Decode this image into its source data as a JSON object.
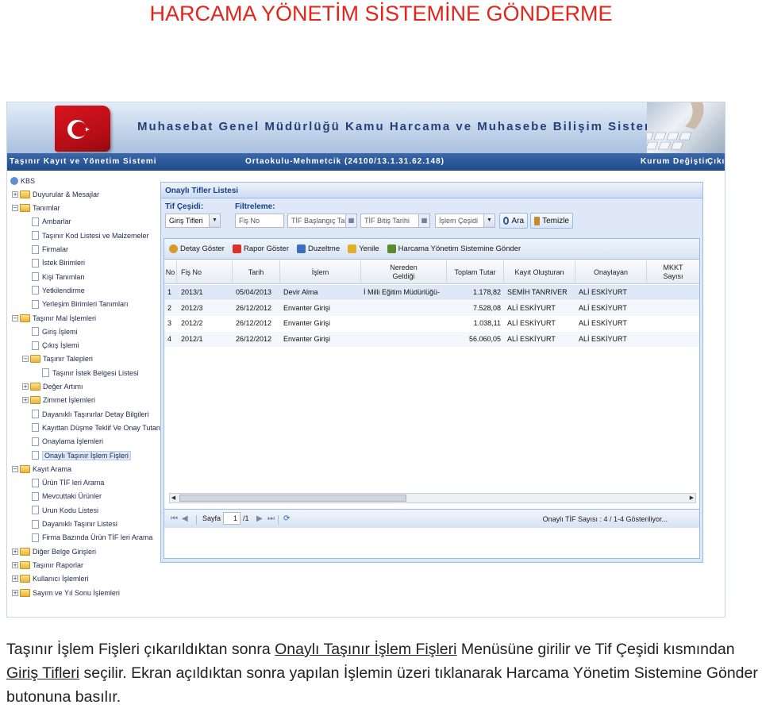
{
  "document": {
    "title": "HARCAMA YÖNETİM SİSTEMİNE GÖNDERME",
    "paragraph": {
      "part1": "Taşınır İşlem Fişleri çıkarıldıktan sonra ",
      "link1": "Onaylı Taşınır İşlem Fişleri",
      "part2": " Menüsüne girilir ve Tif Çeşidi kısmından ",
      "link2": "Giriş Tifleri",
      "part3": " seçilir. Ekran açıldıktan sonra yapılan İşlemin üzeri tıklanarak Harcama Yönetim Sistemine Gönder butonuna basılır."
    }
  },
  "app": {
    "banner_title": "Muhasebat Genel Müdürlüğü Kamu Harcama ve Muhasebe Bilişim Sistemi",
    "system_name": "Taşınır Kayıt ve Yönetim Sistemi",
    "school": "Ortaokulu-Mehmetcik (24100/13.1.31.62.148)",
    "kurum_degistir": "Kurum Değiştir",
    "cikis": "Çıkış",
    "colors": {
      "flag": "#d9141f",
      "navbar": "#1f4a8c",
      "panel_border": "#99bbe8"
    }
  },
  "tree": [
    {
      "label": "KBS",
      "level": 0,
      "type": "root"
    },
    {
      "label": "Duyurular & Mesajlar",
      "level": 1,
      "type": "folder",
      "toggle": "+"
    },
    {
      "label": "Tanımlar",
      "level": 1,
      "type": "folder",
      "toggle": "−"
    },
    {
      "label": "Ambarlar",
      "level": 2,
      "type": "page"
    },
    {
      "label": "Taşınır Kod Listesi ve Malzemeler",
      "level": 2,
      "type": "page"
    },
    {
      "label": "Firmalar",
      "level": 2,
      "type": "page"
    },
    {
      "label": "İstek Birimleri",
      "level": 2,
      "type": "page"
    },
    {
      "label": "Kişi Tanımları",
      "level": 2,
      "type": "page"
    },
    {
      "label": "Yetkilendirme",
      "level": 2,
      "type": "page"
    },
    {
      "label": "Yerleşim Birimleri Tanımları",
      "level": 2,
      "type": "page"
    },
    {
      "label": "Taşınır Mal İşlemleri",
      "level": 1,
      "type": "folder",
      "toggle": "−"
    },
    {
      "label": "Giriş İşlemi",
      "level": 2,
      "type": "page"
    },
    {
      "label": "Çıkış İşlemi",
      "level": 2,
      "type": "page"
    },
    {
      "label": "Taşınır Talepleri",
      "level": 2,
      "type": "folder",
      "toggle": "−"
    },
    {
      "label": "Taşınır İstek Belgesi Listesi",
      "level": 3,
      "type": "page"
    },
    {
      "label": "Değer Artımı",
      "level": 2,
      "type": "folder",
      "toggle": "+"
    },
    {
      "label": "Zimmet İşlemleri",
      "level": 2,
      "type": "folder",
      "toggle": "+"
    },
    {
      "label": "Dayanıklı Taşınırlar Detay Bilgileri",
      "level": 2,
      "type": "page"
    },
    {
      "label": "Kayıttan Düşme Teklif Ve Onay Tutanağı",
      "level": 2,
      "type": "page"
    },
    {
      "label": "Onaylama İşlemleri",
      "level": 2,
      "type": "page"
    },
    {
      "label": "Onaylı Taşınır İşlem Fişleri",
      "level": 2,
      "type": "page",
      "selected": true
    },
    {
      "label": "Kayıt Arama",
      "level": 1,
      "type": "folder",
      "toggle": "−"
    },
    {
      "label": "Ürün TİF leri Arama",
      "level": 2,
      "type": "page"
    },
    {
      "label": "Mevcuttaki Ürünler",
      "level": 2,
      "type": "page"
    },
    {
      "label": "Urun Kodu Listesi",
      "level": 2,
      "type": "page"
    },
    {
      "label": "Dayanıklı Taşınır Listesi",
      "level": 2,
      "type": "page"
    },
    {
      "label": "Firma Bazında Ürün TİF leri Arama",
      "level": 2,
      "type": "page"
    },
    {
      "label": "Diğer Belge Girişleri",
      "level": 1,
      "type": "folder",
      "toggle": "+"
    },
    {
      "label": "Taşınır Raporlar",
      "level": 1,
      "type": "folder",
      "toggle": "+"
    },
    {
      "label": "Kullanıcı İşlemleri",
      "level": 1,
      "type": "folder",
      "toggle": "+"
    },
    {
      "label": "Sayım ve Yıl Sonu İşlemleri",
      "level": 1,
      "type": "folder",
      "toggle": "+"
    }
  ],
  "panel": {
    "title": "Onaylı Tifler Listesi",
    "tif_cesidi_label": "Tif Çeşidi:",
    "tif_cesidi_value": "Giriş Tifleri",
    "filtreleme_label": "Filtreleme:",
    "fis_no_placeholder": "Fiş No",
    "tif_baslangic_placeholder": "TİF Başlangıç Tarihi",
    "tif_bitis_placeholder": "TİF Bitiş Tarihi",
    "islem_cesidi_placeholder": "İşlem Çeşidi",
    "ara_label": "Ara",
    "temizle_label": "Temizle"
  },
  "toolbar": {
    "detay_goster": "Detay Göster",
    "rapor_goster": "Rapor Göster",
    "duzeltme": "Duzeltme",
    "yenile": "Yenile",
    "harcama_gonder": "Harcama Yönetim Sistemine Gönder"
  },
  "grid": {
    "headers": {
      "no": "No",
      "fis_no": "Fiş No",
      "tarih": "Tarih",
      "islem": "İşlem",
      "nereden_1": "Nereden",
      "nereden_2": "Geldiği",
      "toplam_tutar": "Toplam Tutar",
      "kayit_olusturan": "Kayıt Oluşturan",
      "onaylayan": "Onaylayan",
      "mkkt_1": "MKKT",
      "mkkt_2": "Sayısı"
    },
    "rows": [
      {
        "no": "1",
        "fis_no": "2013/1",
        "tarih": "05/04/2013",
        "islem": "Devir Alma",
        "nereden": "İ Milli Eğitim Müdürlüğü-",
        "tutar": "1.178,82",
        "olusturan": "SEMİH TANRIVER",
        "onaylayan": "ALİ ESKİYURT",
        "mkkt": ""
      },
      {
        "no": "2",
        "fis_no": "2012/3",
        "tarih": "26/12/2012",
        "islem": "Envanter Girişi",
        "nereden": "",
        "tutar": "7.528,08",
        "olusturan": "ALİ ESKİYURT",
        "onaylayan": "ALİ ESKİYURT",
        "mkkt": ""
      },
      {
        "no": "3",
        "fis_no": "2012/2",
        "tarih": "26/12/2012",
        "islem": "Envanter Girişi",
        "nereden": "",
        "tutar": "1.038,11",
        "olusturan": "ALİ ESKİYURT",
        "onaylayan": "ALİ ESKİYURT",
        "mkkt": ""
      },
      {
        "no": "4",
        "fis_no": "2012/1",
        "tarih": "26/12/2012",
        "islem": "Envanter Girişi",
        "nereden": "",
        "tutar": "56.060,05",
        "olusturan": "ALİ ESKİYURT",
        "onaylayan": "ALİ ESKİYURT",
        "mkkt": ""
      }
    ]
  },
  "pager": {
    "sayfa_label": "Sayfa",
    "page_value": "1",
    "of_label": "/1",
    "summary": "Onaylı TİF Sayısı : 4 / 1-4 Gösteriliyor..."
  }
}
